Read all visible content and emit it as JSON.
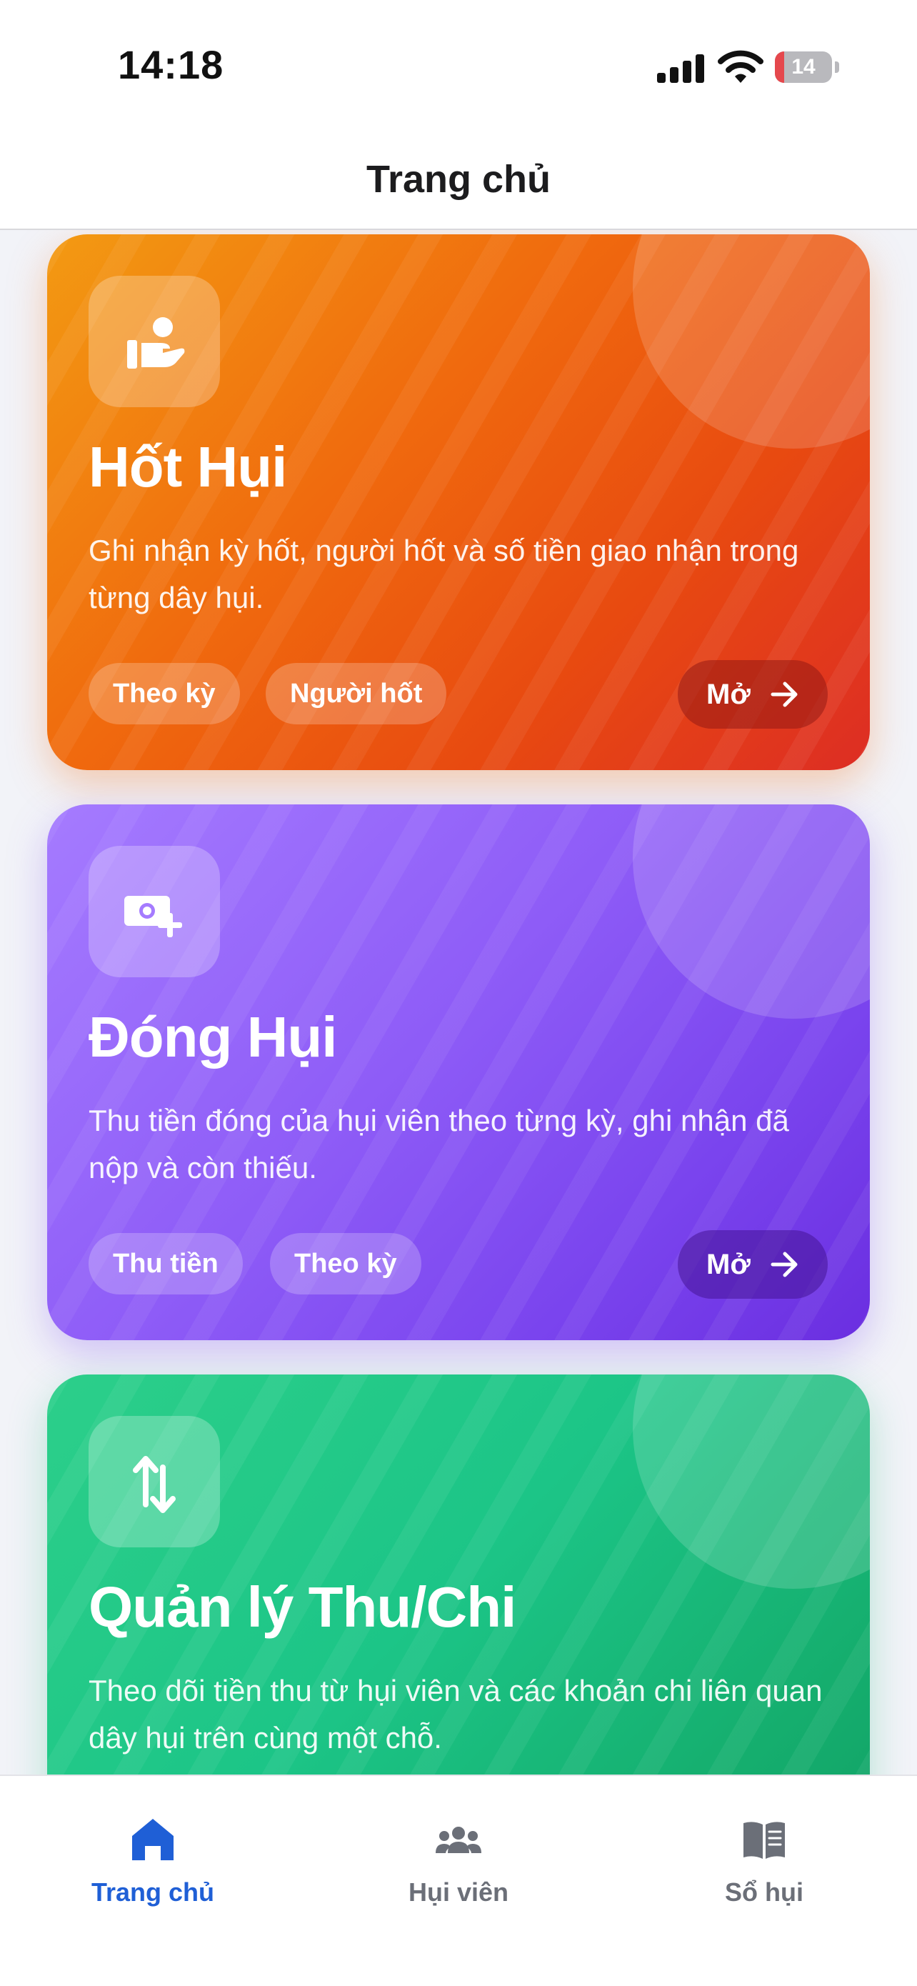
{
  "status_bar": {
    "time": "14:18",
    "battery_level": "14"
  },
  "nav": {
    "title": "Trang chủ"
  },
  "cards": [
    {
      "title": "Hốt Hụi",
      "description": "Ghi nhận kỳ hốt, người hốt và số tiền giao nhận trong từng dây hụi.",
      "chips": [
        "Theo kỳ",
        "Người hốt"
      ],
      "open_label": "Mở",
      "icon": "hand-user-icon",
      "color": "#f06a0e"
    },
    {
      "title": "Đóng Hụi",
      "description": "Thu tiền đóng của hụi viên theo từng kỳ, ghi nhận đã nộp và còn thiếu.",
      "chips": [
        "Thu tiền",
        "Theo kỳ"
      ],
      "open_label": "Mở",
      "icon": "money-add-icon",
      "color": "#8e5cf7"
    },
    {
      "title": "Quản lý Thu/Chi",
      "description": "Theo dõi tiền thu từ hụi viên và các khoản chi liên quan dây hụi trên cùng một chỗ.",
      "icon": "transfer-arrows-icon",
      "color": "#1cc587"
    }
  ],
  "tabs": [
    {
      "label": "Trang chủ",
      "icon": "home-icon",
      "active": true
    },
    {
      "label": "Hụi viên",
      "icon": "group-icon",
      "active": false
    },
    {
      "label": "Sổ hụi",
      "icon": "book-icon",
      "active": false
    }
  ],
  "colors": {
    "accent": "#1f5fd6",
    "inactive_tab": "#6b6f78"
  }
}
